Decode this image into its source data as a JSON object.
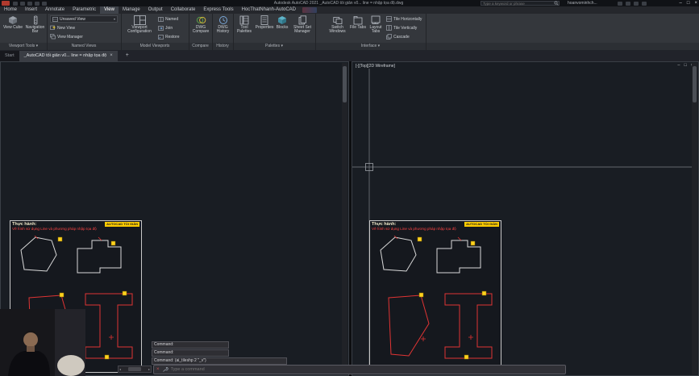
{
  "icons": {
    "minimize": "–",
    "maximize": "□",
    "close": "×",
    "caret": "▾",
    "plus": "+",
    "left_arrow": "◂",
    "right_arrow": "▸"
  },
  "titlebar": {
    "app_title": "Autodesk AutoCAD 2021  _AutoCAD tối giản v0... line = nhập tọa độ.dwg",
    "search_placeholder": "Type a keyword or phrase",
    "user": "hoanvominhch..."
  },
  "ribbon": {
    "tabs": [
      "Home",
      "Insert",
      "Annotate",
      "Parametric",
      "View",
      "Manage",
      "Output",
      "Collaborate",
      "Express Tools",
      "HocThatNhanh-AutoCAD"
    ],
    "viewport_tools": {
      "label": "Viewport Tools",
      "view_cube": "View Cube",
      "nav_bar": "Navigation Bar"
    },
    "named_views": {
      "label": "Named Views",
      "unsaved": "Unsaved View",
      "new_view": "New View",
      "view_manager": "View Manager"
    },
    "model_viewports": {
      "label": "Model Viewports",
      "config": "Viewport Configuration",
      "named": "Named",
      "join": "Join",
      "restore": "Restore"
    },
    "compare": {
      "label": "Compare",
      "dwg_compare": "DWG Compare"
    },
    "history": {
      "label": "History",
      "dwg_history": "DWG History"
    },
    "palettes": {
      "label": "Palettes",
      "tool_palettes": "Tool Palettes",
      "properties": "Properties",
      "blocks": "Blocks",
      "sheet_set": "Sheet Set Manager"
    },
    "interface": {
      "label": "Interface",
      "switch_windows": "Switch Windows",
      "file_tabs": "File Tabs",
      "layout_tabs": "Layout Tabs",
      "tile_h": "Tile Horizontally",
      "tile_v": "Tile Vertically",
      "cascade": "Cascade"
    }
  },
  "file_tabs": {
    "start": "Start",
    "document": "_AutoCAD tối giản v0... line = nhập tọa độ"
  },
  "right_window": {
    "viewport_label": "[-][Top][2D Wireframe]"
  },
  "sheet": {
    "heading": "Thực hành:",
    "subtitle": "Vẽ hình sử dụng Line và phương pháp nhập tọa độ",
    "badge": "AUTOCAD TỐI GIẢN"
  },
  "command": {
    "history": [
      "Command:",
      "Command:",
      "Command: (ai_tileshp 2 \"_v\")"
    ],
    "placeholder": "Type a command"
  }
}
